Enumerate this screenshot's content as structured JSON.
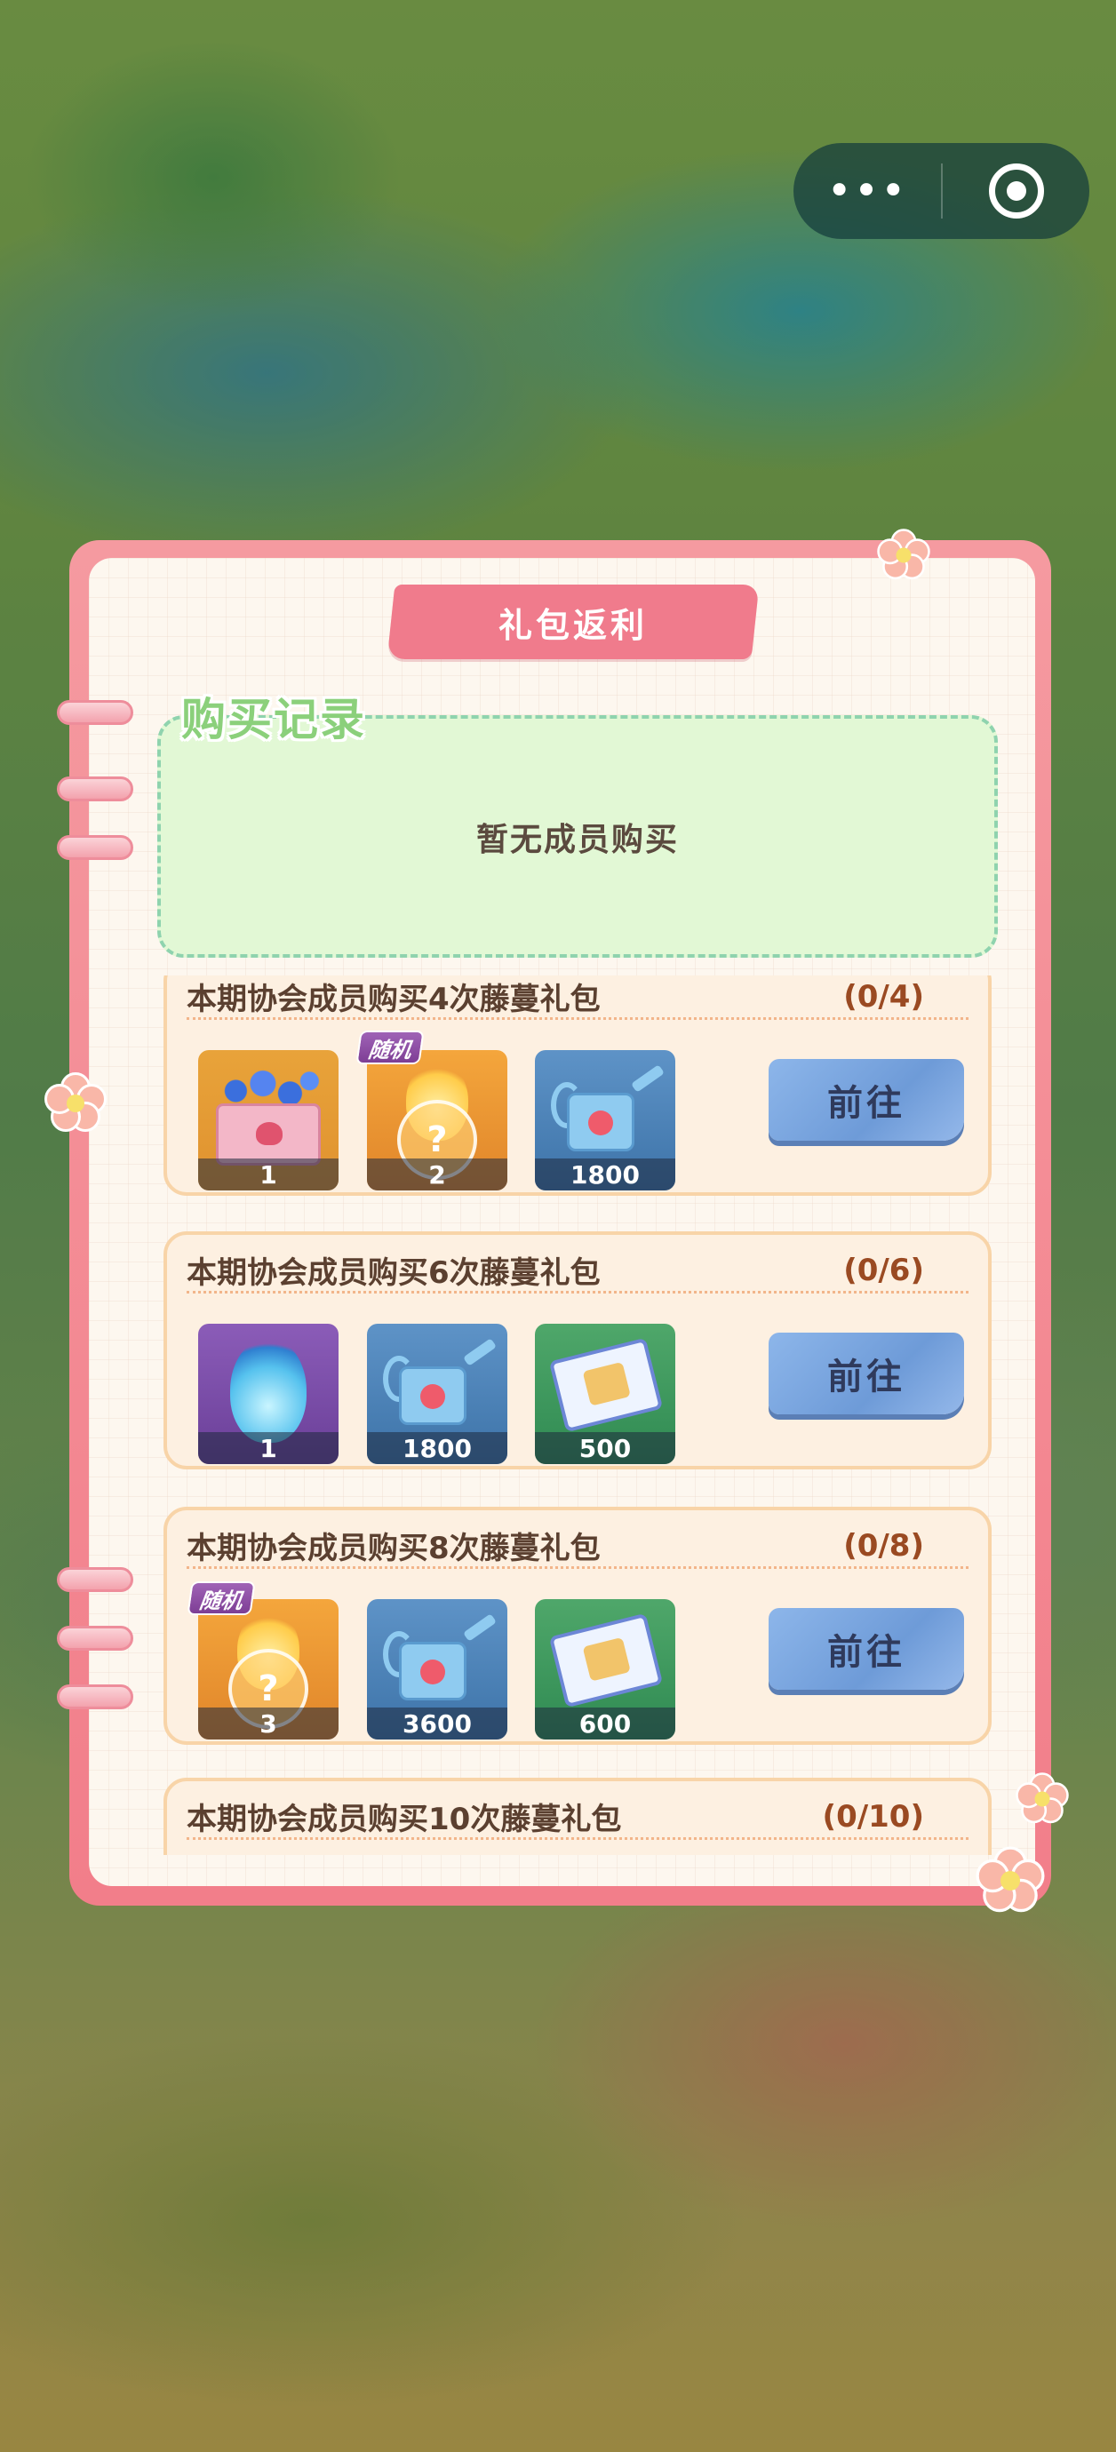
{
  "capsule": {
    "more_icon": "more-dots-icon",
    "close_icon": "close-target-icon"
  },
  "panel": {
    "title": "礼包返利",
    "record_title": "购买记录",
    "record_empty": "暂无成员购买",
    "go_label": "前往"
  },
  "gifts": [
    {
      "title": "本期协会成员购买4次藤蔓礼包",
      "progress": "(0/4)",
      "items": [
        {
          "icon": "flower-envelope-icon",
          "qty": "1",
          "random": false
        },
        {
          "icon": "mystery-fire-badge-icon",
          "qty": "2",
          "random": true,
          "random_label": "随机"
        },
        {
          "icon": "watering-can-icon",
          "qty": "1800",
          "random": false
        }
      ]
    },
    {
      "title": "本期协会成员购买6次藤蔓礼包",
      "progress": "(0/6)",
      "items": [
        {
          "icon": "blue-flame-icon",
          "qty": "1",
          "random": false
        },
        {
          "icon": "watering-can-icon",
          "qty": "1800",
          "random": false
        },
        {
          "icon": "ticket-icon",
          "qty": "500",
          "random": false
        }
      ]
    },
    {
      "title": "本期协会成员购买8次藤蔓礼包",
      "progress": "(0/8)",
      "items": [
        {
          "icon": "mystery-fire-badge-icon",
          "qty": "3",
          "random": true,
          "random_label": "随机"
        },
        {
          "icon": "watering-can-icon",
          "qty": "3600",
          "random": false
        },
        {
          "icon": "ticket-icon",
          "qty": "600",
          "random": false
        }
      ]
    },
    {
      "title": "本期协会成员购买10次藤蔓礼包",
      "progress": "(0/10)",
      "items": []
    }
  ],
  "colors": {
    "panel_border": "#f27e8a",
    "record_bg": "#e2f8d5",
    "card_bg": "#fdf0e1",
    "button": "#7aa6df",
    "random_tag": "#8a4aa3"
  }
}
